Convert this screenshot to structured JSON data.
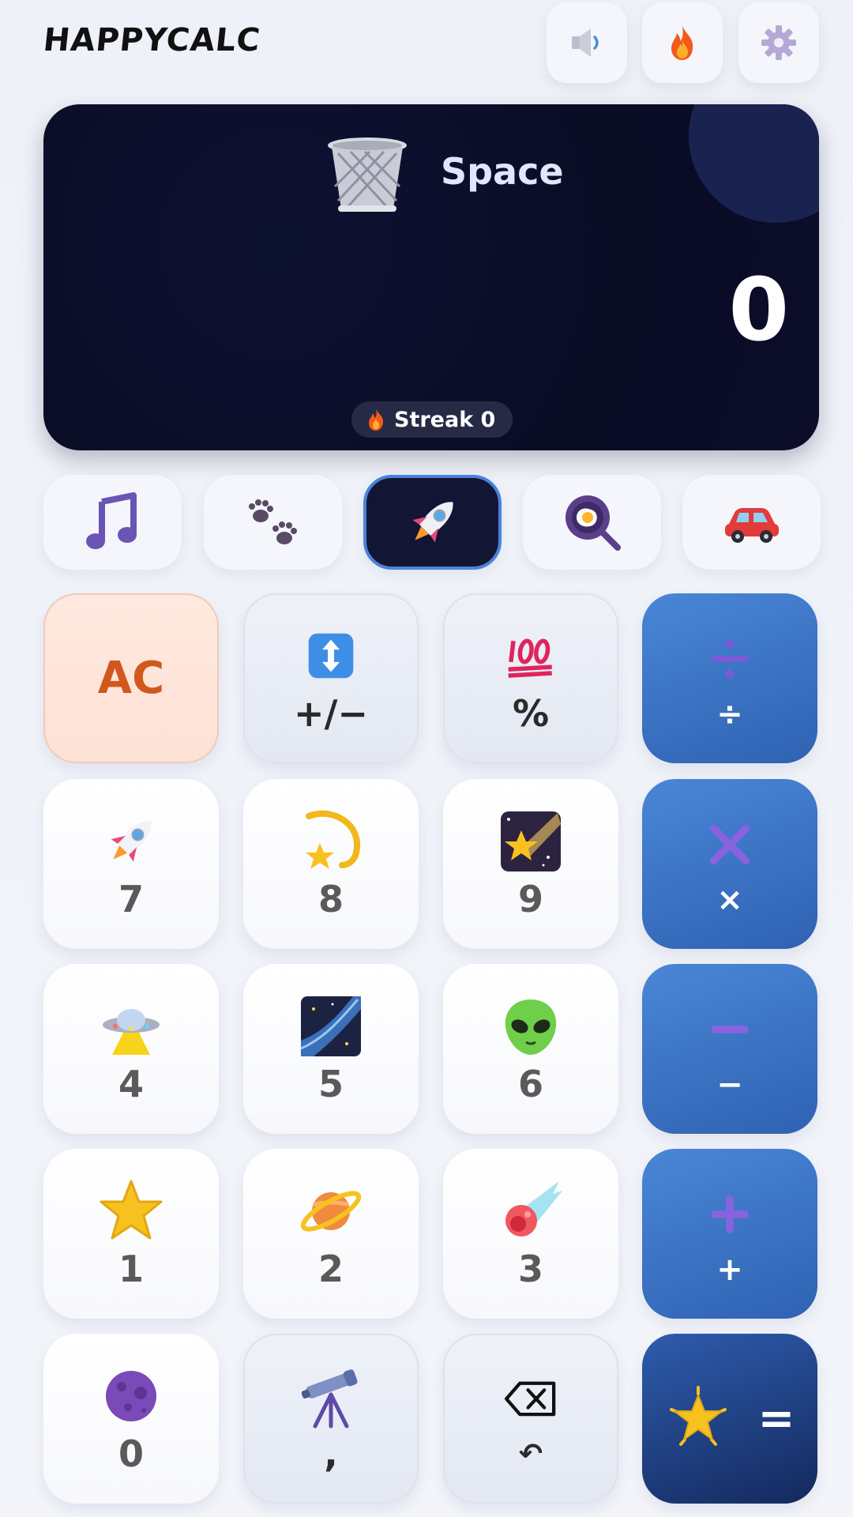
{
  "header": {
    "title": "HAPPYCALC",
    "buttons": [
      {
        "name": "sound-button",
        "icon": "speaker-icon"
      },
      {
        "name": "streak-button",
        "icon": "fire-icon"
      },
      {
        "name": "settings-button",
        "icon": "gear-icon"
      }
    ]
  },
  "display": {
    "theme_icon": "wastebasket-icon",
    "theme_name": "Space",
    "value": "0",
    "streak_label": "Streak 0"
  },
  "themes": [
    {
      "name": "music",
      "icon": "music-notes-icon",
      "active": false
    },
    {
      "name": "animals",
      "icon": "paw-prints-icon",
      "active": false
    },
    {
      "name": "space",
      "icon": "rocket-icon",
      "active": true
    },
    {
      "name": "food",
      "icon": "frying-pan-egg-icon",
      "active": false
    },
    {
      "name": "vehicles",
      "icon": "car-icon",
      "active": false
    }
  ],
  "keys": {
    "ac": "AC",
    "sign": "+/−",
    "percent": "%",
    "divide": "÷",
    "seven": "7",
    "eight": "8",
    "nine": "9",
    "multiply": "×",
    "four": "4",
    "five": "5",
    "six": "6",
    "minus": "−",
    "one": "1",
    "two": "2",
    "three": "3",
    "plus": "+",
    "zero": "0",
    "comma": ",",
    "undo": "↶",
    "equals": "="
  },
  "colors": {
    "accent": "#4a82d8",
    "operator": "#3b72c4",
    "display_bg": "#0a0c24",
    "ac_text": "#d0581e"
  }
}
